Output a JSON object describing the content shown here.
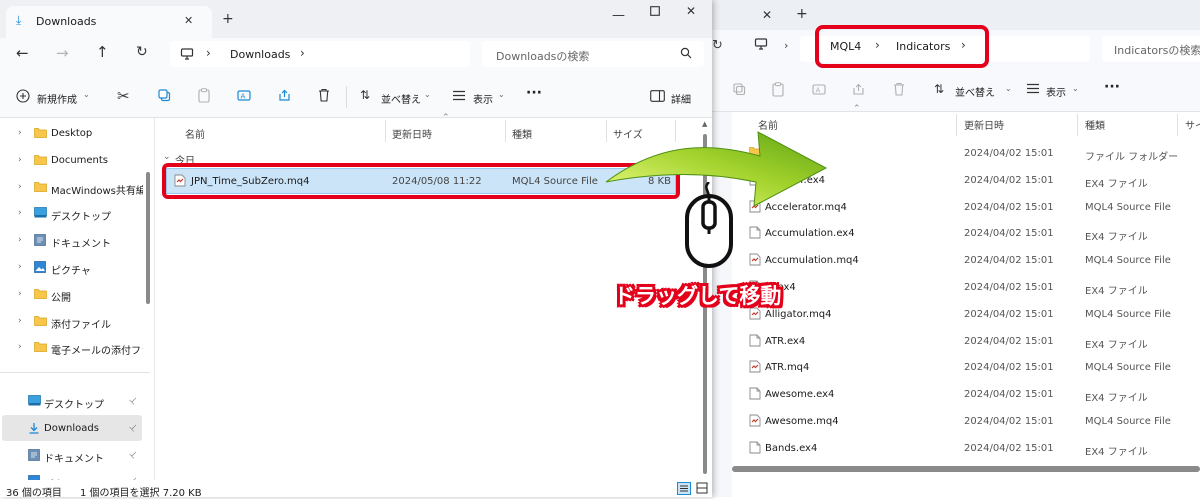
{
  "right_window": {
    "breadcrumb": [
      "MQL4",
      "Indicators"
    ],
    "search_placeholder": "Indicatorsの検索",
    "cmd": {
      "sort": "並べ替え",
      "view": "表示"
    },
    "columns": {
      "name": "名前",
      "date": "更新日時",
      "type": "種類",
      "size": "サイ"
    },
    "files": [
      {
        "name": "les",
        "date": "2024/04/02 15:01",
        "type": "ファイル フォルダー",
        "icon": "folder-icon"
      },
      {
        "name": "elerator.ex4",
        "date": "2024/04/02 15:01",
        "type": "EX4 ファイル",
        "icon": "file-icon"
      },
      {
        "name": "Accelerator.mq4",
        "date": "2024/04/02 15:01",
        "type": "MQL4 Source File",
        "icon": "mq4-file-icon"
      },
      {
        "name": "Accumulation.ex4",
        "date": "2024/04/02 15:01",
        "type": "EX4 ファイル",
        "icon": "file-icon"
      },
      {
        "name": "Accumulation.mq4",
        "date": "2024/04/02 15:01",
        "type": "MQL4 Source File",
        "icon": "mq4-file-icon"
      },
      {
        "name": "or.ex4",
        "date": "2024/04/02 15:01",
        "type": "EX4 ファイル",
        "icon": "file-icon"
      },
      {
        "name": "Alligator.mq4",
        "date": "2024/04/02 15:01",
        "type": "MQL4 Source File",
        "icon": "mq4-file-icon"
      },
      {
        "name": "ATR.ex4",
        "date": "2024/04/02 15:01",
        "type": "EX4 ファイル",
        "icon": "file-icon"
      },
      {
        "name": "ATR.mq4",
        "date": "2024/04/02 15:01",
        "type": "MQL4 Source File",
        "icon": "mq4-file-icon"
      },
      {
        "name": "Awesome.ex4",
        "date": "2024/04/02 15:01",
        "type": "EX4 ファイル",
        "icon": "file-icon"
      },
      {
        "name": "Awesome.mq4",
        "date": "2024/04/02 15:01",
        "type": "MQL4 Source File",
        "icon": "mq4-file-icon"
      },
      {
        "name": "Bands.ex4",
        "date": "2024/04/02 15:01",
        "type": "EX4 ファイル",
        "icon": "file-icon"
      }
    ]
  },
  "left_window": {
    "tab_title": "Downloads",
    "new_tab": "+",
    "breadcrumb": [
      "Downloads"
    ],
    "search_placeholder": "Downloadsの検索",
    "cmd": {
      "new": "新規作成",
      "sort": "並べ替え",
      "view": "表示",
      "details": "詳細"
    },
    "columns": {
      "name": "名前",
      "date": "更新日時",
      "type": "種類",
      "size": "サイズ"
    },
    "group_label": "今日",
    "file": {
      "name": "JPN_Time_SubZero.mq4",
      "date": "2024/05/08 11:22",
      "type": "MQL4 Source File",
      "size": "8 KB"
    },
    "sidebar_tree": [
      {
        "label": "Desktop",
        "icon": "folder-icon"
      },
      {
        "label": "Documents",
        "icon": "folder-icon"
      },
      {
        "label": "MacWindows共有編",
        "icon": "folder-icon"
      },
      {
        "label": "デスクトップ",
        "icon": "desktop-icon"
      },
      {
        "label": "ドキュメント",
        "icon": "document-icon"
      },
      {
        "label": "ピクチャ",
        "icon": "picture-icon"
      },
      {
        "label": "公開",
        "icon": "folder-icon"
      },
      {
        "label": "添付ファイル",
        "icon": "folder-icon"
      },
      {
        "label": "電子メールの添付ファイ",
        "icon": "folder-icon"
      }
    ],
    "quick_access": [
      {
        "label": "デスクトップ",
        "icon": "desktop-icon",
        "selected": false
      },
      {
        "label": "Downloads",
        "icon": "download-icon",
        "selected": true
      },
      {
        "label": "ドキュメント",
        "icon": "document-icon",
        "selected": false
      },
      {
        "label": "ピクチャ",
        "icon": "picture-icon",
        "selected": false
      }
    ],
    "status": {
      "count": "36 個の項目",
      "selection": "1 個の項目を選択  7.20 KB"
    }
  },
  "annotation": {
    "text": "ドラッグして移動",
    "color": "#e4001b",
    "arrow_color": "#7dc11c"
  }
}
